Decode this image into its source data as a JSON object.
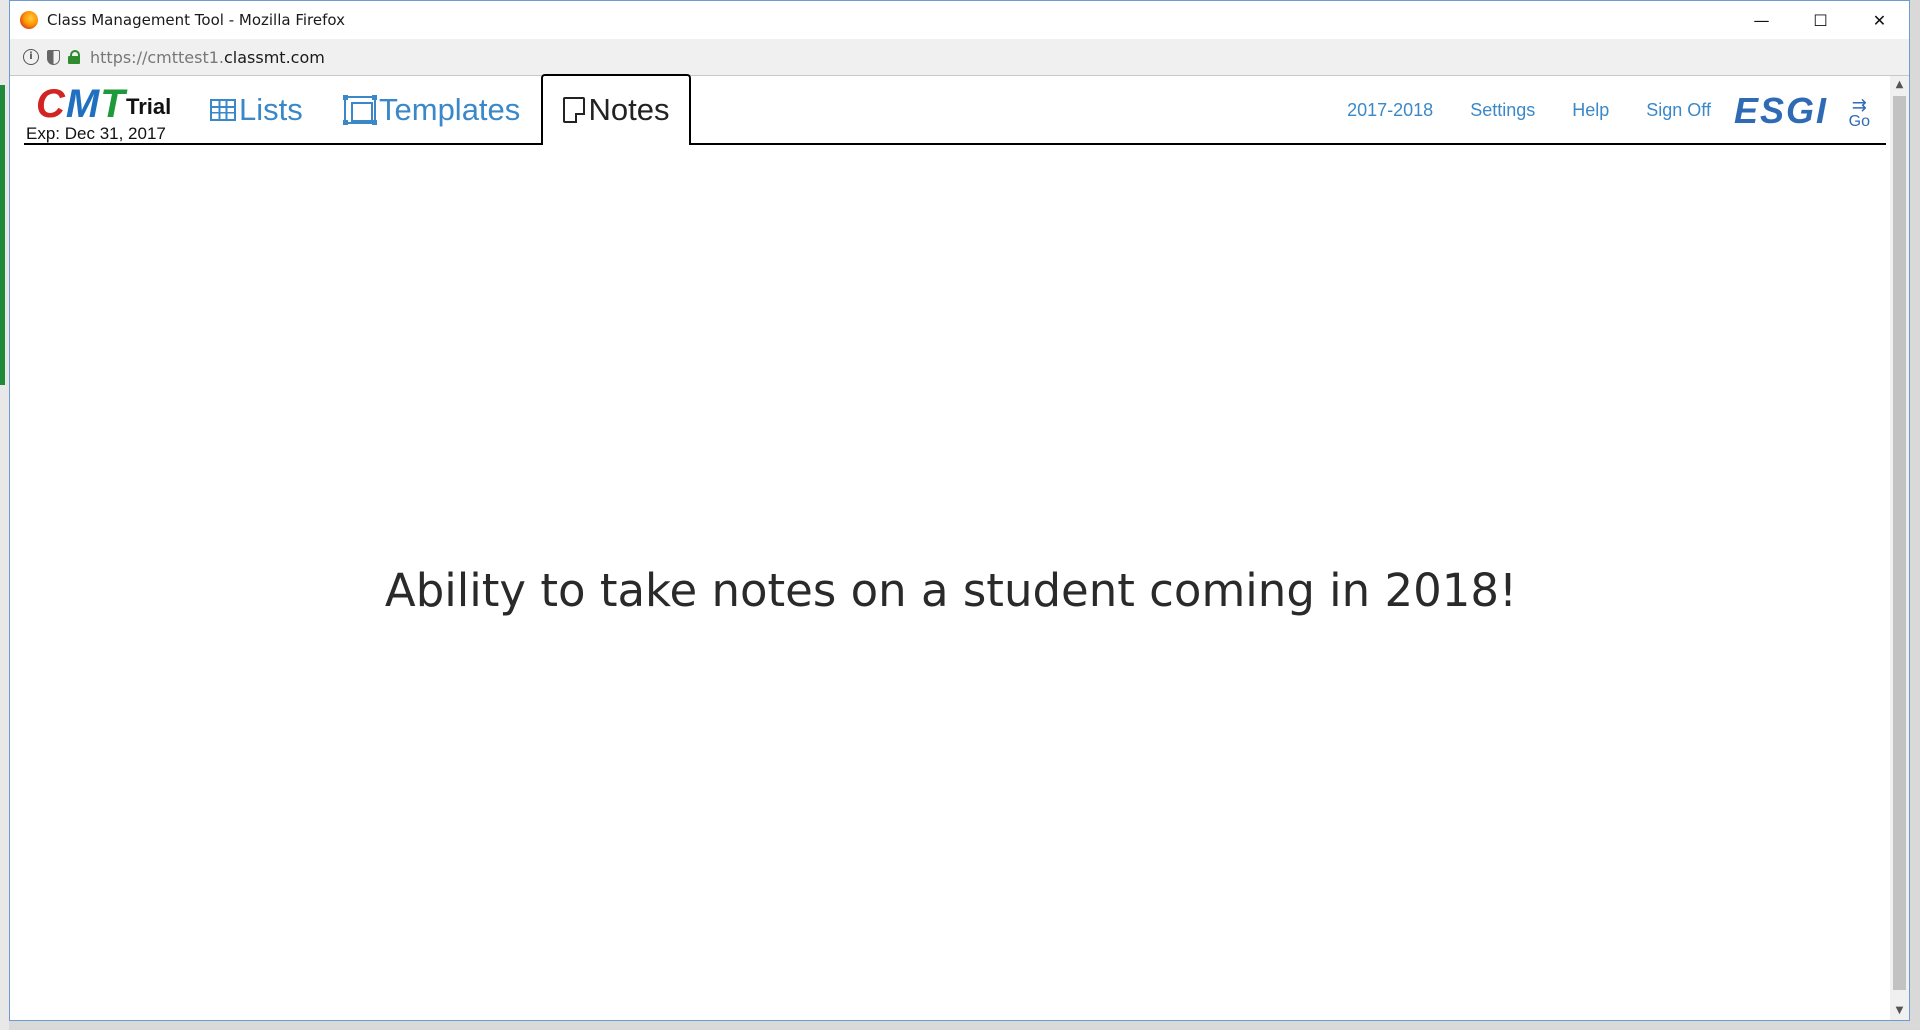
{
  "window": {
    "title": "Class Management Tool - Mozilla Firefox",
    "controls": {
      "minimize": "—",
      "maximize": "☐",
      "close": "✕"
    }
  },
  "addressbar": {
    "url_scheme": "https://cmttest1.",
    "url_host": "classmt.com"
  },
  "header": {
    "logo": "CMT",
    "logo_letters": [
      "C",
      "M",
      "T"
    ],
    "trial_label": "Trial",
    "expiry": "Exp: Dec 31, 2017",
    "tabs": [
      {
        "label": "Lists",
        "icon": "grid-icon"
      },
      {
        "label": "Templates",
        "icon": "templates-icon"
      },
      {
        "label": "Notes",
        "icon": "note-icon",
        "active": true
      }
    ],
    "right_links": [
      {
        "label": "2017-2018"
      },
      {
        "label": "Settings"
      },
      {
        "label": "Help"
      },
      {
        "label": "Sign Off"
      }
    ],
    "esgi_logo": "ESGI",
    "go_label": "Go"
  },
  "main": {
    "message": "Ability to take notes on a student coming in 2018!"
  },
  "colors": {
    "link": "#3b88c8",
    "cmt_c": "#d32424",
    "cmt_m": "#2070c0",
    "cmt_t": "#1e9a3a",
    "esgi": "#2f6bb5"
  }
}
